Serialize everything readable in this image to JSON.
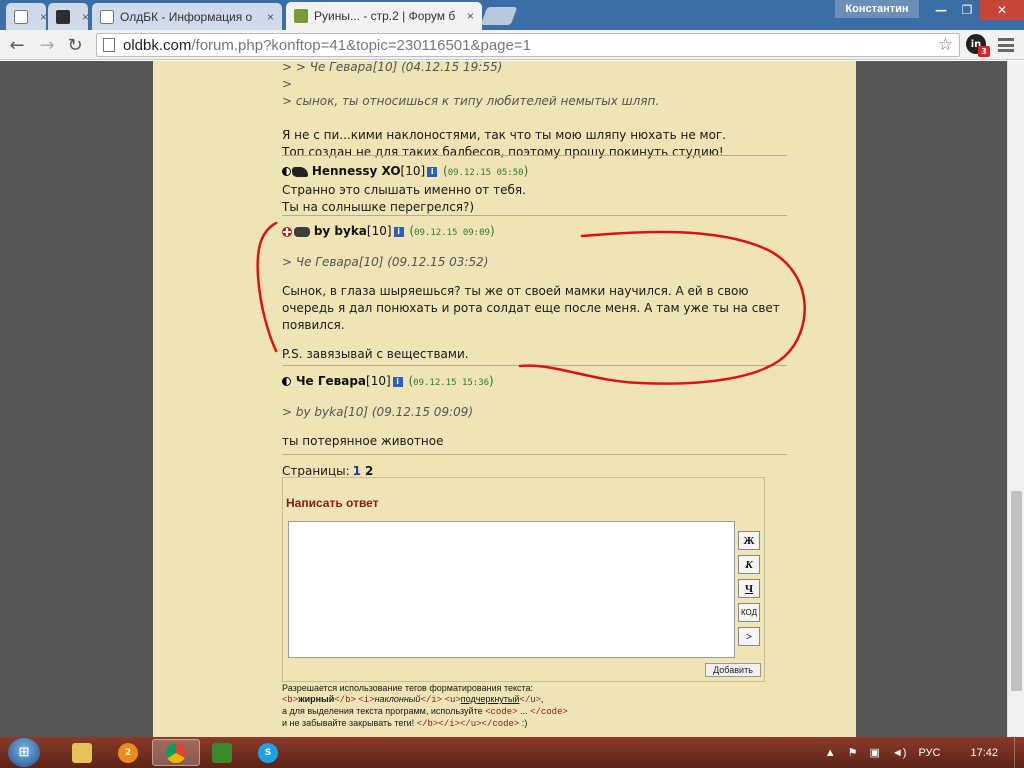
{
  "browser": {
    "tabs": [
      {
        "title": "",
        "icon": "page-icon"
      },
      {
        "title": "",
        "icon": "horse-icon"
      },
      {
        "title": "ОлдБК - Информация о",
        "icon": "page-icon"
      },
      {
        "title": "Руины... - стр.2 | Форум б",
        "icon": "forum-icon"
      }
    ],
    "user": "Константин",
    "url_host": "oldbk.com",
    "url_path": "/forum.php?konftop=41&topic=230116501&page=1",
    "extension_label": "in",
    "extension_count": "3"
  },
  "thread": {
    "top_quote": {
      "header": "> > Че Гевара[10] (04.12.15 19:55)",
      "blank": ">",
      "quote": "> сынок, ты относишься к типу любителей немытых шляп.",
      "lines": [
        "Я не с пи...кими наклоностями, так что ты мою шляпу нюхать не мог.",
        "Топ создан не для таких балбесов, поэтому прошу покинуть студию!"
      ]
    },
    "posts": [
      {
        "author": "Hennessy XO",
        "level": "[10]",
        "time": "09.12.15 05:50",
        "lines": [
          "Странно это слышать именно от тебя.",
          "Ты на солнышке перегрелся?)"
        ]
      },
      {
        "author": "by byka",
        "level": "[10]",
        "time": "09.12.15 09:09",
        "quote": "> Че Гевара[10] (09.12.15 03:52)",
        "body": "Сынок, в глаза шыряешься? ты же от своей мамки научился. А ей в свою очередь я дал понюхать и рота солдат еще после меня. А там уже ты на свет появился.",
        "ps": "P.S. завязывай с веществами."
      },
      {
        "author": "Че Гевара",
        "level": "[10]",
        "time": "09.12.15 15:36",
        "quote": "> by byka[10] (09.12.15 09:09)",
        "body": "ты потерянное животное"
      }
    ],
    "pages_label": "Страницы:",
    "page_1": "1",
    "page_2": "2"
  },
  "reply": {
    "title": "Написать ответ",
    "buttons": {
      "bold": "Ж",
      "italic": "К",
      "underline": "Ч",
      "code": "КОД",
      "arrow": ">"
    },
    "submit": "Добавить",
    "help": {
      "line1": "Разрешается использование тегов форматирования текста:",
      "b_open": "<b>",
      "b_text": "жирный",
      "b_close": "</b>",
      "i_open": "<i>",
      "i_text": "наклонный",
      "i_close": "</i>",
      "u_open": "<u>",
      "u_text": "подчеркнутый",
      "u_close": "</u>",
      "comma": ",",
      "line3a": "а для выделения текста программ, используйте",
      "code_open": "<code>",
      "dots": "...",
      "code_close": "</code>",
      "line4a": "и не забывайте закрывать теги!",
      "closing_tags": "</b></i></u></code>",
      "smile": ":)"
    }
  },
  "taskbar": {
    "lang": "РУС",
    "clock": "17:42"
  },
  "colors": {
    "page_bg": "#565656",
    "forum_bg": "#efe4b5",
    "title_red": "#8a1c12",
    "timestamp_green": "#2e7d2e",
    "annotation_red": "#e01010"
  }
}
